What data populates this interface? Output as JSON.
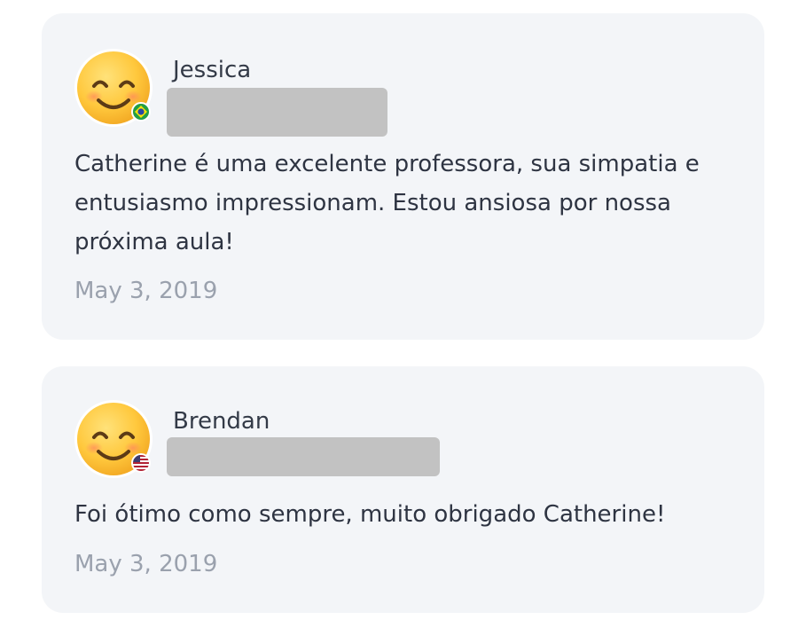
{
  "reviews": [
    {
      "name": "Jessica",
      "avatar_icon": "smiling-face-emoji-icon",
      "country_flag_icon": "brazil-flag-icon",
      "text": "Catherine é uma excelente professora, sua simpatia e entusiasmo impressionam. Estou ansiosa por nossa próxima aula!",
      "date": "May 3, 2019"
    },
    {
      "name": "Brendan",
      "avatar_icon": "smiling-face-emoji-icon",
      "country_flag_icon": "us-flag-icon",
      "text": "Foi ótimo como sempre, muito obrigado Catherine!",
      "date": "May 3, 2019"
    }
  ],
  "colors": {
    "card_background": "#f3f5f8",
    "name_text": "#333a47",
    "body_text": "#2e3442",
    "date_text": "#9aa1ad",
    "redaction": "#c2c2c2"
  }
}
